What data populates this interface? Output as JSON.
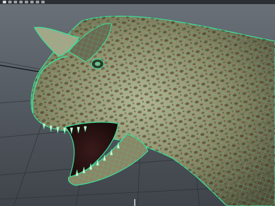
{
  "viewport": {
    "background_top": "#6a7178",
    "background_bottom": "#3f444a",
    "wireframe_color": "#39e39a",
    "grid_color": "#2a2e33",
    "subject": "dinosaur-head-model"
  },
  "toolbar": {
    "icons": [
      "select-tool-icon",
      "move-tool-icon",
      "rotate-tool-icon",
      "scale-tool-icon",
      "snap-icon",
      "camera-icon",
      "render-icon",
      "settings-icon"
    ]
  }
}
